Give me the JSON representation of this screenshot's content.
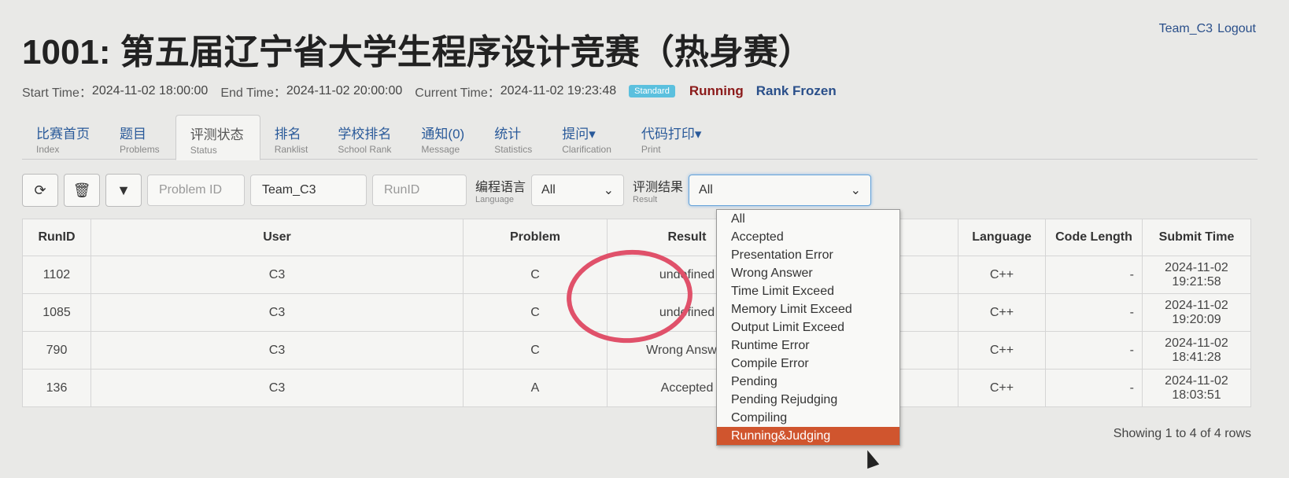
{
  "user": {
    "name": "Team_C3",
    "logout": "Logout"
  },
  "contest": {
    "title": "1001: 第五届辽宁省大学生程序设计竞赛（热身赛）",
    "start_label": "Start Time：",
    "start": "2024-11-02 18:00:00",
    "end_label": "End Time：",
    "end": "2024-11-02 20:00:00",
    "current_label": "Current Time：",
    "current": "2024-11-02 19:23:48",
    "badge": "Standard",
    "status": "Running",
    "frozen": "Rank Frozen"
  },
  "tabs": [
    {
      "zh": "比赛首页",
      "en": "Index"
    },
    {
      "zh": "题目",
      "en": "Problems"
    },
    {
      "zh": "评测状态",
      "en": "Status"
    },
    {
      "zh": "排名",
      "en": "Ranklist"
    },
    {
      "zh": "学校排名",
      "en": "School Rank"
    },
    {
      "zh": "通知(0)",
      "en": "Message"
    },
    {
      "zh": "统计",
      "en": "Statistics"
    },
    {
      "zh": "提问▾",
      "en": "Clarification"
    },
    {
      "zh": "代码打印▾",
      "en": "Print"
    }
  ],
  "filters": {
    "problem_placeholder": "Problem ID",
    "user_value": "Team_C3",
    "runid_placeholder": "RunID",
    "language_zh": "编程语言",
    "language_en": "Language",
    "language_value": "All",
    "result_zh": "评测结果",
    "result_en": "Result",
    "result_value": "All"
  },
  "table": {
    "headers": [
      "RunID",
      "User",
      "Problem",
      "Result",
      "Language",
      "Code Length",
      "Submit Time"
    ],
    "rows": [
      {
        "runid": "1102",
        "user": "C3",
        "problem": "C",
        "result": "undefined",
        "language": "C++",
        "length": "-",
        "time": "2024-11-02 19:21:58"
      },
      {
        "runid": "1085",
        "user": "C3",
        "problem": "C",
        "result": "undefined",
        "language": "C++",
        "length": "-",
        "time": "2024-11-02 19:20:09"
      },
      {
        "runid": "790",
        "user": "C3",
        "problem": "C",
        "result": "Wrong Answer",
        "language": "C++",
        "length": "-",
        "time": "2024-11-02 18:41:28"
      },
      {
        "runid": "136",
        "user": "C3",
        "problem": "A",
        "result": "Accepted",
        "language": "C++",
        "length": "-",
        "time": "2024-11-02 18:03:51"
      }
    ]
  },
  "dropdown": {
    "options": [
      "All",
      "Accepted",
      "Presentation Error",
      "Wrong Answer",
      "Time Limit Exceed",
      "Memory Limit Exceed",
      "Output Limit Exceed",
      "Runtime Error",
      "Compile Error",
      "Pending",
      "Pending Rejudging",
      "Compiling",
      "Running&Judging"
    ],
    "highlighted": 12
  },
  "footer": "Showing 1 to 4 of 4 rows",
  "colors": {
    "running": "#8b1a1a",
    "link": "#2a4f8a",
    "highlight": "#d0552e",
    "annotation": "#e0516a"
  }
}
